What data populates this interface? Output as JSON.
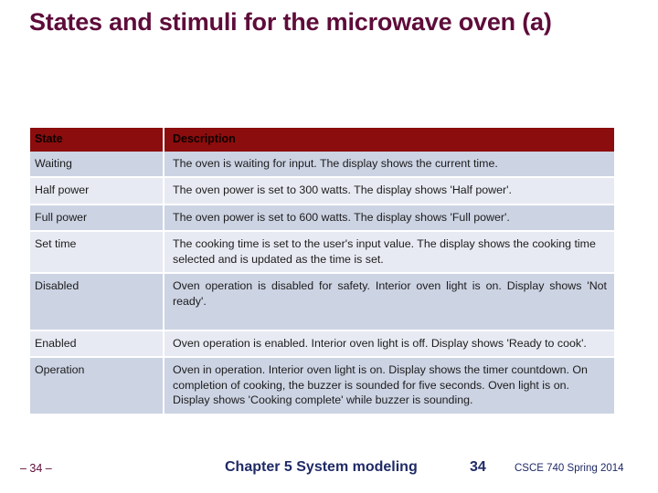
{
  "slide": {
    "title": "States and stimuli for the microwave oven (a)",
    "title_color": "#5e0c3a"
  },
  "table": {
    "header_bg": "#8c0d0d",
    "header_text_color": "#0d0000",
    "row_bg_odd": "#ccd3e3",
    "row_bg_even": "#e7eaf2",
    "columns": [
      "State",
      "Description"
    ],
    "rows": [
      {
        "state": "Waiting",
        "description": "The oven is waiting for input. The display shows the current time.",
        "justified": false
      },
      {
        "state": "Half power",
        "description": "The oven power is set to 300 watts. The display shows 'Half power'.",
        "justified": false
      },
      {
        "state": "Full power",
        "description": "The oven power is set to 600 watts. The display shows 'Full power'.",
        "justified": false
      },
      {
        "state": "Set time",
        "description": "The cooking time is set to the user's input value. The display shows the cooking time selected and is updated as the time is set.",
        "justified": false
      },
      {
        "state": "Disabled",
        "description": "Oven operation is disabled for safety. Interior oven light is on. Display shows 'Not ready'.",
        "justified": true
      },
      {
        "state": "Enabled",
        "description": "Oven operation is enabled. Interior oven light is off. Display shows 'Ready to cook'.",
        "justified": false
      },
      {
        "state": "Operation",
        "description": "Oven in operation. Interior oven light is on. Display shows the timer countdown. On completion of cooking, the buzzer is sounded for five seconds. Oven light is on. Display shows 'Cooking complete' while buzzer is sounding.",
        "justified": false
      }
    ]
  },
  "footer": {
    "left_marker": "– 34 –",
    "center_text": "Chapter 5 System modeling",
    "page_number": "34",
    "course_text": "CSCE 740 Spring  2014",
    "color": "#1f2a66"
  }
}
